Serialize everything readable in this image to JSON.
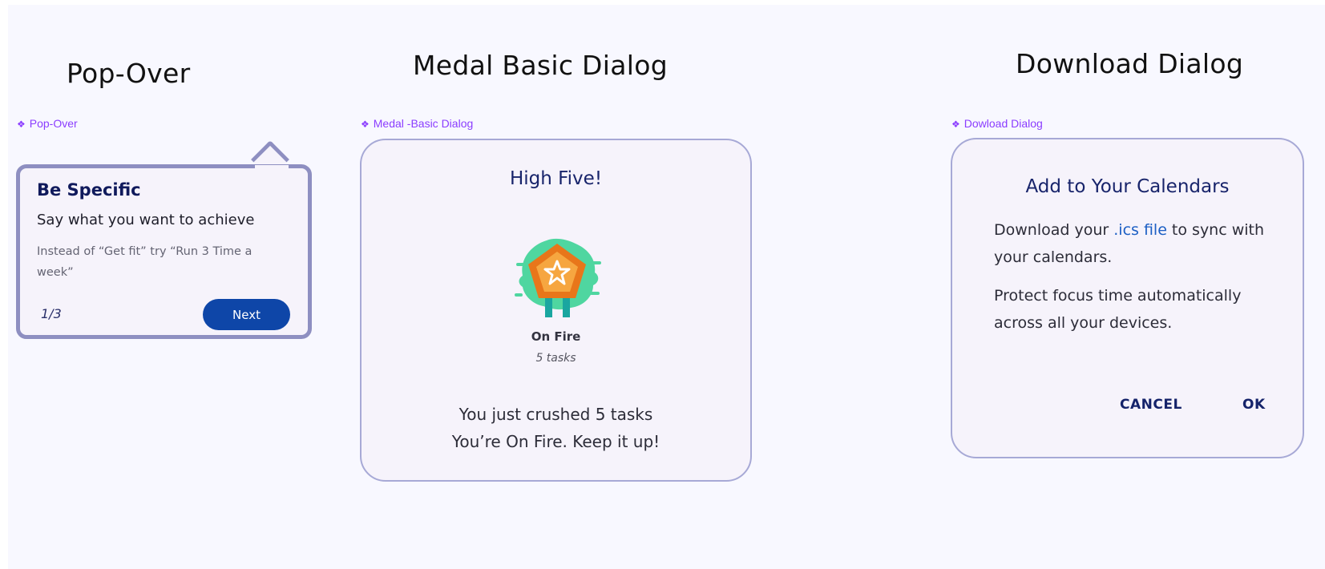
{
  "sections": {
    "popover_title": "Pop-Over",
    "medal_title": "Medal Basic Dialog",
    "download_title": "Download Dialog"
  },
  "component_labels": {
    "popover": "Pop-Over",
    "medal": "Medal -Basic Dialog",
    "download": "Dowload Dialog",
    "icon": "component-diamond-icon"
  },
  "popover": {
    "title": "Be Specific",
    "subtitle": "Say what you want to achieve",
    "body": "Instead of “Get fit” try “Run 3 Time a week”",
    "page": "1/3",
    "next_label": "Next"
  },
  "medal_dialog": {
    "title": "High Five!",
    "medal_icon": "on-fire-medal-icon",
    "medal_name": "On Fire",
    "medal_count": "5  tasks",
    "message_line1": "You just crushed 5 tasks",
    "message_line2": "You’re On Fire. Keep it up!"
  },
  "download_dialog": {
    "title": "Add to Your Calendars",
    "body_prefix": "Download your ",
    "body_link": ".ics file",
    "body_suffix": " to sync with your calendars.",
    "body2": "Protect focus time automatically across all your devices.",
    "cancel_label": "CANCEL",
    "ok_label": "OK"
  },
  "colors": {
    "accent_purple": "#8b3dff",
    "navy_title": "#18246b",
    "primary_button": "#0e46a8",
    "dialog_bg": "#f6f3fb",
    "dialog_border": "#a7a9d6",
    "popover_border": "#8e8fc1",
    "link_blue": "#1c5fc4",
    "medal_orange": "#f08a24",
    "medal_green": "#4fd6a0"
  }
}
